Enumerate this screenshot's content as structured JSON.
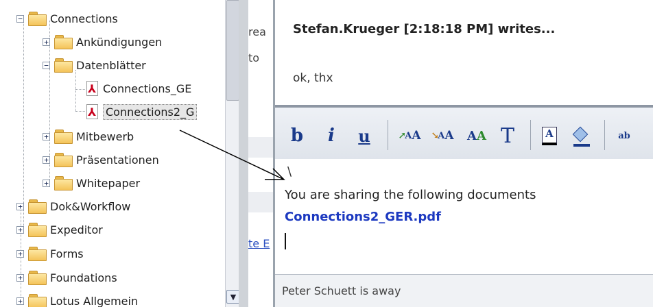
{
  "tree": {
    "items": [
      {
        "label": "Connections",
        "type": "folder",
        "toggle": "−"
      },
      {
        "label": "Ankündigungen",
        "type": "folder",
        "toggle": "+"
      },
      {
        "label": "Datenblätter",
        "type": "folder",
        "toggle": "−"
      },
      {
        "label": "Connections_GE",
        "type": "pdf"
      },
      {
        "label": "Connections2_G",
        "type": "pdf",
        "selected": true
      },
      {
        "label": "Mitbewerb",
        "type": "folder",
        "toggle": "+"
      },
      {
        "label": "Präsentationen",
        "type": "folder",
        "toggle": "+"
      },
      {
        "label": "Whitepaper",
        "type": "folder",
        "toggle": "+"
      },
      {
        "label": "Dok&Workflow",
        "type": "folder",
        "toggle": "+"
      },
      {
        "label": "Expeditor",
        "type": "folder",
        "toggle": "+"
      },
      {
        "label": "Forms",
        "type": "folder",
        "toggle": "+"
      },
      {
        "label": "Foundations",
        "type": "folder",
        "toggle": "+"
      },
      {
        "label": "Lotus Allgemein",
        "type": "folder",
        "toggle": "+"
      }
    ],
    "scroll_down_icon": "chevron-down-icon"
  },
  "middle": {
    "frag_1": "rea",
    "frag_2": "to",
    "frag_link": "te E"
  },
  "chat": {
    "writer_line": "Stefan.Krueger [2:18:18 PM] writes...",
    "message": "ok, thx",
    "toolbar": {
      "bold": "b",
      "italic": "i",
      "underline": "u",
      "grow_font": "A",
      "shrink_font": "A",
      "font_style": "A",
      "font": "T",
      "text_color": "A",
      "background_color": "fill-icon",
      "more": "ab"
    },
    "compose": {
      "cursor_mark": "\\",
      "share_text": "You are sharing the following documents",
      "share_link": "Connections2_GER.pdf"
    },
    "status": "Peter Schuett is away"
  },
  "colors": {
    "link": "#1c39c0",
    "folder": "#f4c359",
    "pdf": "#c8001c"
  }
}
